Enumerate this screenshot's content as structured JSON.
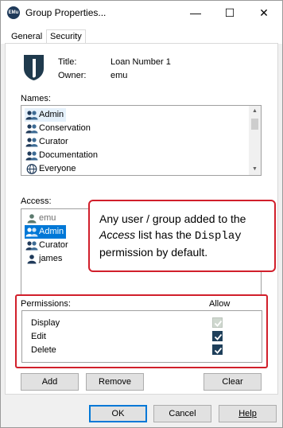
{
  "window": {
    "icon_text": "EMu",
    "title": "Group Properties...",
    "controls": {
      "minimize": "—",
      "maximize": "☐",
      "close": "✕"
    }
  },
  "tabs": [
    {
      "label": "General",
      "active": false
    },
    {
      "label": "Security",
      "active": true
    }
  ],
  "header": {
    "title_label": "Title:",
    "title_value": "Loan Number 1",
    "owner_label": "Owner:",
    "owner_value": "emu"
  },
  "names": {
    "label": "Names:",
    "items": [
      {
        "label": "Admin",
        "icon": "group-icon",
        "selected": true
      },
      {
        "label": "Conservation",
        "icon": "group-icon"
      },
      {
        "label": "Curator",
        "icon": "group-icon"
      },
      {
        "label": "Documentation",
        "icon": "group-icon"
      },
      {
        "label": "Everyone",
        "icon": "globe-icon"
      }
    ]
  },
  "access": {
    "label": "Access:",
    "items": [
      {
        "label": "emu",
        "icon": "user-icon",
        "greyed": true
      },
      {
        "label": "Admin",
        "icon": "group-icon",
        "selected": true
      },
      {
        "label": "Curator",
        "icon": "group-icon"
      },
      {
        "label": "james",
        "icon": "user-icon"
      }
    ]
  },
  "callout": {
    "part1": "Any user / group added to the ",
    "part2": "Access",
    "part3": " list has the ",
    "part4": "Display",
    "part5": " permission by default."
  },
  "permissions": {
    "label": "Permissions:",
    "allow_label": "Allow",
    "rows": [
      {
        "label": "Display",
        "checked": true,
        "disabled": true
      },
      {
        "label": "Edit",
        "checked": true,
        "disabled": false
      },
      {
        "label": "Delete",
        "checked": true,
        "disabled": false
      }
    ]
  },
  "buttons": {
    "add": "Add",
    "remove": "Remove",
    "clear": "Clear",
    "ok": "OK",
    "cancel": "Cancel",
    "help": "Help"
  },
  "colors": {
    "highlight_red": "#d11f2b",
    "selection_blue": "#0078d7",
    "checkbox_navy": "#1e3f5a",
    "shield_navy": "#1f3a4d"
  }
}
